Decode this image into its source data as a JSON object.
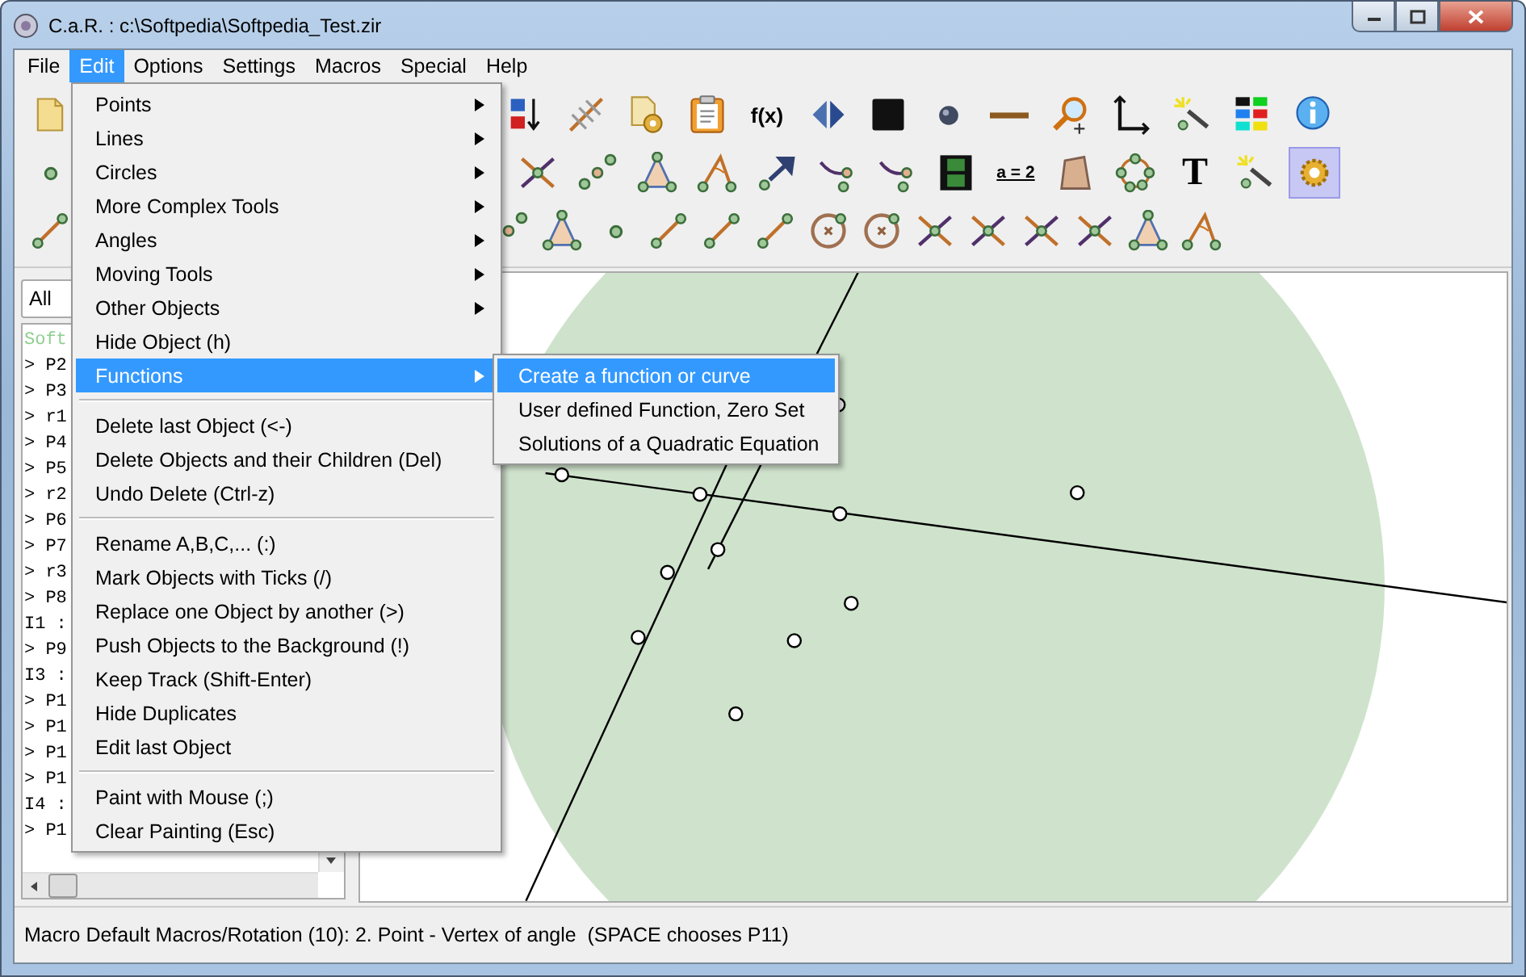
{
  "window": {
    "title": "C.a.R. : c:\\Softpedia\\Softpedia_Test.zir"
  },
  "menubar": [
    {
      "label": "File",
      "selected": false
    },
    {
      "label": "Edit",
      "selected": true
    },
    {
      "label": "Options",
      "selected": false
    },
    {
      "label": "Settings",
      "selected": false
    },
    {
      "label": "Macros",
      "selected": false
    },
    {
      "label": "Special",
      "selected": false
    },
    {
      "label": "Help",
      "selected": false
    }
  ],
  "toolbar": {
    "rows": [
      {
        "left": [
          {
            "kind": "doc",
            "selected": false
          }
        ],
        "right": [
          {
            "kind": "sort",
            "selected": false
          },
          {
            "kind": "hatch",
            "selected": false
          },
          {
            "kind": "gear-doc",
            "selected": false
          },
          {
            "kind": "clipboard",
            "selected": false
          },
          {
            "kind": "label",
            "text": "f(x)",
            "selected": false
          },
          {
            "kind": "arrows",
            "selected": false
          },
          {
            "kind": "square",
            "selected": false
          },
          {
            "kind": "ball",
            "selected": false
          },
          {
            "kind": "bar",
            "selected": false
          },
          {
            "kind": "zoom",
            "selected": false
          },
          {
            "kind": "axes",
            "selected": false
          },
          {
            "kind": "wand",
            "selected": false
          },
          {
            "kind": "palette",
            "selected": false
          },
          {
            "kind": "info",
            "selected": false
          }
        ]
      },
      {
        "left": [
          {
            "kind": "dot",
            "selected": false
          }
        ],
        "right": [
          {
            "kind": "cross",
            "selected": false
          },
          {
            "kind": "points",
            "selected": false
          },
          {
            "kind": "triangle",
            "selected": false
          },
          {
            "kind": "angle",
            "selected": false
          },
          {
            "kind": "arrow",
            "selected": false
          },
          {
            "kind": "curve",
            "selected": false
          },
          {
            "kind": "curve",
            "selected": false
          },
          {
            "kind": "film",
            "selected": false
          },
          {
            "kind": "label",
            "text": "a = 2",
            "selected": false
          },
          {
            "kind": "quad",
            "selected": false
          },
          {
            "kind": "ring",
            "selected": false
          },
          {
            "kind": "label",
            "text": "T",
            "selected": false
          },
          {
            "kind": "wand",
            "selected": false
          },
          {
            "kind": "gear",
            "selected": true
          }
        ]
      },
      {
        "left": [
          {
            "kind": "segment",
            "selected": false
          }
        ],
        "right": [
          {
            "kind": "points",
            "selected": false
          },
          {
            "kind": "triangle",
            "selected": false
          },
          {
            "kind": "dot",
            "selected": false
          },
          {
            "kind": "segment",
            "selected": false
          },
          {
            "kind": "segment",
            "selected": false
          },
          {
            "kind": "segment",
            "selected": false
          },
          {
            "kind": "circle",
            "selected": false
          },
          {
            "kind": "circle",
            "selected": false
          },
          {
            "kind": "cross",
            "selected": false
          },
          {
            "kind": "cross",
            "selected": false
          },
          {
            "kind": "cross",
            "selected": false
          },
          {
            "kind": "cross",
            "selected": false
          },
          {
            "kind": "triangle",
            "selected": false
          },
          {
            "kind": "angle",
            "selected": false
          }
        ]
      }
    ]
  },
  "object_list": {
    "filter": "All",
    "lines": [
      {
        "kind": "comment",
        "text": "Soft"
      },
      {
        "kind": "object",
        "text": "> P2"
      },
      {
        "kind": "object",
        "text": "> P3"
      },
      {
        "kind": "object",
        "text": "> r1"
      },
      {
        "kind": "object",
        "text": "> P4"
      },
      {
        "kind": "object",
        "text": "> P5"
      },
      {
        "kind": "object",
        "text": "> r2"
      },
      {
        "kind": "object",
        "text": "> P6"
      },
      {
        "kind": "object",
        "text": "> P7"
      },
      {
        "kind": "object",
        "text": "> r3"
      },
      {
        "kind": "object",
        "text": "> P8"
      },
      {
        "kind": "object",
        "text": "I1 :"
      },
      {
        "kind": "object",
        "text": "> P9"
      },
      {
        "kind": "object",
        "text": "I3 :"
      },
      {
        "kind": "object",
        "text": "> P1"
      },
      {
        "kind": "object",
        "text": "> P1"
      },
      {
        "kind": "object",
        "text": "> P1"
      },
      {
        "kind": "object",
        "text": "> P1"
      },
      {
        "kind": "object",
        "text": "I4 :"
      },
      {
        "kind": "object",
        "text": "> P1"
      }
    ]
  },
  "edit_menu": [
    {
      "kind": "item",
      "label": "Points",
      "submenu": true,
      "selected": false
    },
    {
      "kind": "item",
      "label": "Lines",
      "submenu": true,
      "selected": false
    },
    {
      "kind": "item",
      "label": "Circles",
      "submenu": true,
      "selected": false
    },
    {
      "kind": "item",
      "label": "More Complex Tools",
      "submenu": true,
      "selected": false
    },
    {
      "kind": "item",
      "label": "Angles",
      "submenu": true,
      "selected": false
    },
    {
      "kind": "item",
      "label": "Moving Tools",
      "submenu": true,
      "selected": false
    },
    {
      "kind": "item",
      "label": "Other Objects",
      "submenu": true,
      "selected": false
    },
    {
      "kind": "item",
      "label": "Hide Object (h)",
      "submenu": false,
      "selected": false
    },
    {
      "kind": "item",
      "label": "Functions",
      "submenu": true,
      "selected": true
    },
    {
      "kind": "separator"
    },
    {
      "kind": "item",
      "label": "Delete last Object (<-)",
      "submenu": false,
      "selected": false
    },
    {
      "kind": "item",
      "label": "Delete Objects and their Children (Del)",
      "submenu": false,
      "selected": false
    },
    {
      "kind": "item",
      "label": "Undo Delete (Ctrl-z)",
      "submenu": false,
      "selected": false
    },
    {
      "kind": "separator"
    },
    {
      "kind": "item",
      "label": "Rename A,B,C,... (:)",
      "submenu": false,
      "selected": false
    },
    {
      "kind": "item",
      "label": "Mark Objects with Ticks (/)",
      "submenu": false,
      "selected": false
    },
    {
      "kind": "item",
      "label": "Replace one Object by another (>)",
      "submenu": false,
      "selected": false
    },
    {
      "kind": "item",
      "label": "Push Objects to the Background (!)",
      "submenu": false,
      "selected": false
    },
    {
      "kind": "item",
      "label": "Keep Track (Shift-Enter)",
      "submenu": false,
      "selected": false
    },
    {
      "kind": "item",
      "label": "Hide Duplicates",
      "submenu": false,
      "selected": false
    },
    {
      "kind": "item",
      "label": "Edit last Object",
      "submenu": false,
      "selected": false
    },
    {
      "kind": "separator"
    },
    {
      "kind": "item",
      "label": "Paint with Mouse (;)",
      "submenu": false,
      "selected": false
    },
    {
      "kind": "item",
      "label": "Clear Painting (Esc)",
      "submenu": false,
      "selected": false
    }
  ],
  "functions_submenu": [
    {
      "label": "Create a function or curve",
      "selected": true
    },
    {
      "label": "User defined Function, Zero Set",
      "selected": false
    },
    {
      "label": "Solutions of a Quadratic Equation",
      "selected": false
    }
  ],
  "status_bar": {
    "text": "Macro Default Macros/Rotation (10): 2. Point - Vertex of angle  (SPACE chooses P11)"
  }
}
